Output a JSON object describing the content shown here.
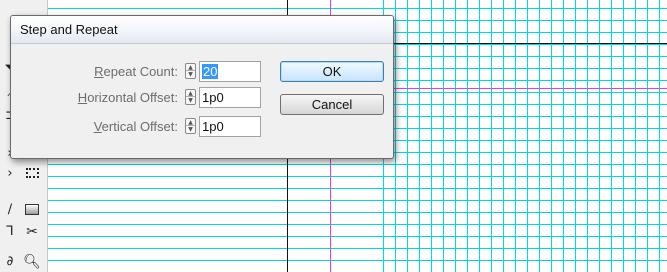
{
  "dialog": {
    "title": "Step and Repeat",
    "fields": {
      "repeat_count": {
        "label_mnemonic": "R",
        "label_rest": "epeat Count:",
        "value": "20"
      },
      "horizontal_offset": {
        "label_mnemonic": "H",
        "label_rest": "orizontal Offset:",
        "value": "1p0"
      },
      "vertical_offset": {
        "label_mnemonic": "V",
        "label_rest": "ertical Offset:",
        "value": "1p0"
      }
    },
    "buttons": {
      "ok": "OK",
      "cancel": "Cancel"
    }
  },
  "colors": {
    "guide_cyan": "#00d8e8",
    "guide_magenta": "#e040e0",
    "margin_black": "#111111",
    "selection_blue": "#3399ff"
  },
  "toolbar": {
    "tools": [
      {
        "icon": "pen-icon"
      },
      {
        "icon": "pencil-icon"
      },
      {
        "icon": "type-icon"
      },
      {
        "icon": "line-icon"
      },
      {
        "icon": "free-transform-icon"
      },
      {
        "icon": "rectangle-frame-icon"
      },
      {
        "icon": "gradient-swatch-icon"
      },
      {
        "icon": "scissors-icon"
      },
      {
        "icon": "zoom-icon"
      }
    ]
  }
}
